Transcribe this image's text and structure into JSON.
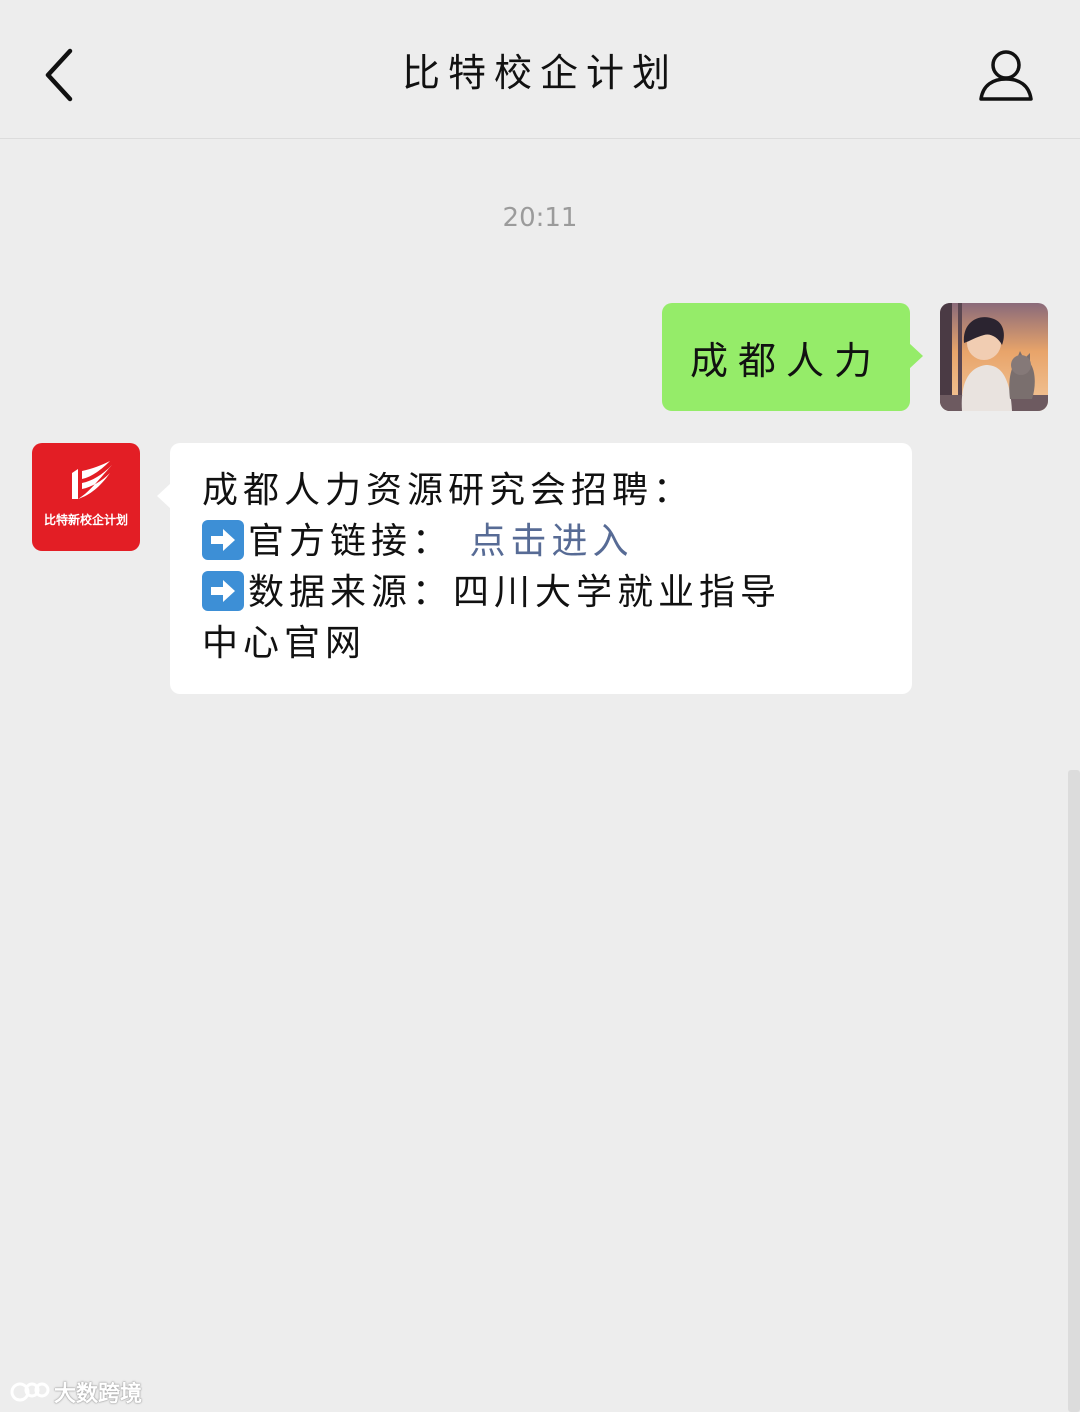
{
  "header": {
    "title": "比特校企计划",
    "back_icon": "chevron-left-icon",
    "profile_icon": "person-icon"
  },
  "chat": {
    "timestamp": "20:11",
    "outgoing": {
      "text": "成都人力"
    },
    "incoming": {
      "avatar_label": "比特新校企计划",
      "line1": "成都人力资源研究会招聘：",
      "line2_label": "官方链接：",
      "line2_link": "点击进入",
      "line3": "数据来源：四川大学就业指导",
      "line4": "中心官网"
    }
  },
  "watermark": {
    "text": "大数跨境"
  },
  "colors": {
    "background": "#ededed",
    "outgoing_bubble": "#95ec69",
    "incoming_bubble": "#ffffff",
    "link": "#576b95",
    "account_avatar": "#e31e25"
  }
}
